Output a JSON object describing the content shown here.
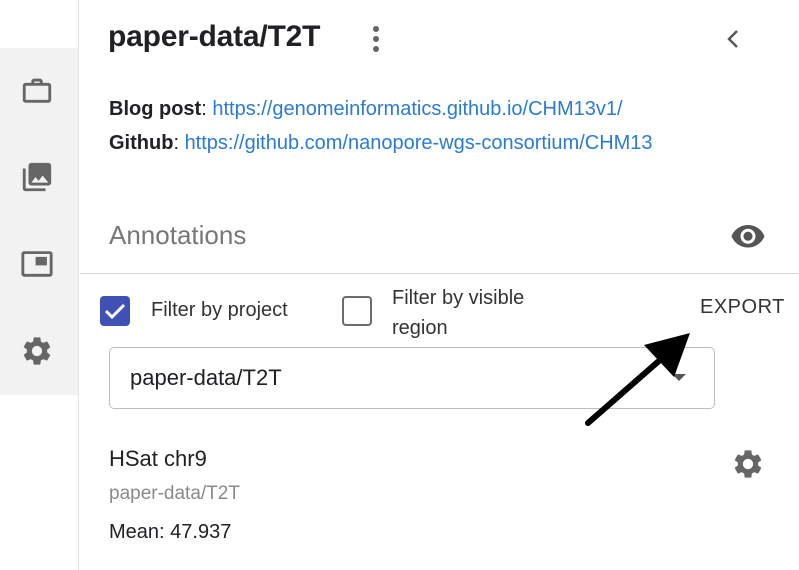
{
  "rail": {
    "icons": [
      "briefcase-icon",
      "gallery-icon",
      "picture-in-picture-icon",
      "gear-icon"
    ]
  },
  "header": {
    "title": "paper-data/T2T"
  },
  "info": {
    "blog_key": "Blog post",
    "blog_sep": ": ",
    "blog_url": "https://genomeinformatics.github.io/CHM13v1/",
    "github_key": "Github",
    "github_sep": ": ",
    "github_url": "https://github.com/nanopore-wgs-consortium/CHM13"
  },
  "annotations": {
    "title": "Annotations",
    "filter_project_label": "Filter by project",
    "filter_project_checked": true,
    "filter_visible_line1": "Filter by visible",
    "filter_visible_line2": "region",
    "filter_visible_checked": false,
    "export_label": "EXPORT",
    "project_select_value": "paper-data/T2T"
  },
  "tracks": [
    {
      "name": "HSat chr9",
      "project": "paper-data/T2T",
      "mean": "Mean: 47.937"
    }
  ],
  "colors": {
    "accent": "#3f51b5",
    "link": "#2b7bd0",
    "muted": "#777777"
  }
}
